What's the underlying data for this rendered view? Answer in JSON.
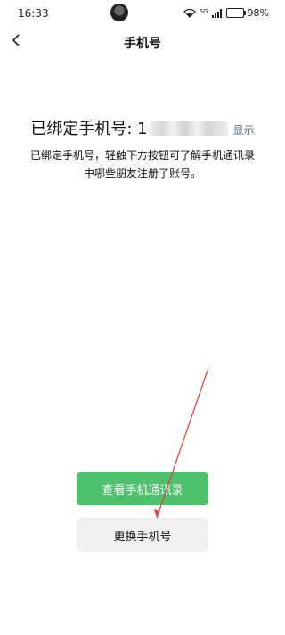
{
  "status_bar": {
    "time": "16:33",
    "icons": [
      "avatar-icon",
      "wifi-icon",
      "signal-5g-icon",
      "battery-icon"
    ],
    "battery": "98%",
    "battery_inner": "5G"
  },
  "header": {
    "title": "手机号",
    "back_icon": "back-arrow-icon"
  },
  "phone": {
    "label": "已绑定手机号: 1",
    "show_link": "显示"
  },
  "description": "已绑定手机号，轻触下方按钮可了解手机通讯录中哪些朋友注册了账号。",
  "buttons": {
    "view_contacts": "查看手机通讯录",
    "change_phone": "更换手机号"
  },
  "colors": {
    "primary": "#4ec16c",
    "secondary_bg": "#efefef",
    "link": "#576b95",
    "annotation": "#e53935"
  }
}
